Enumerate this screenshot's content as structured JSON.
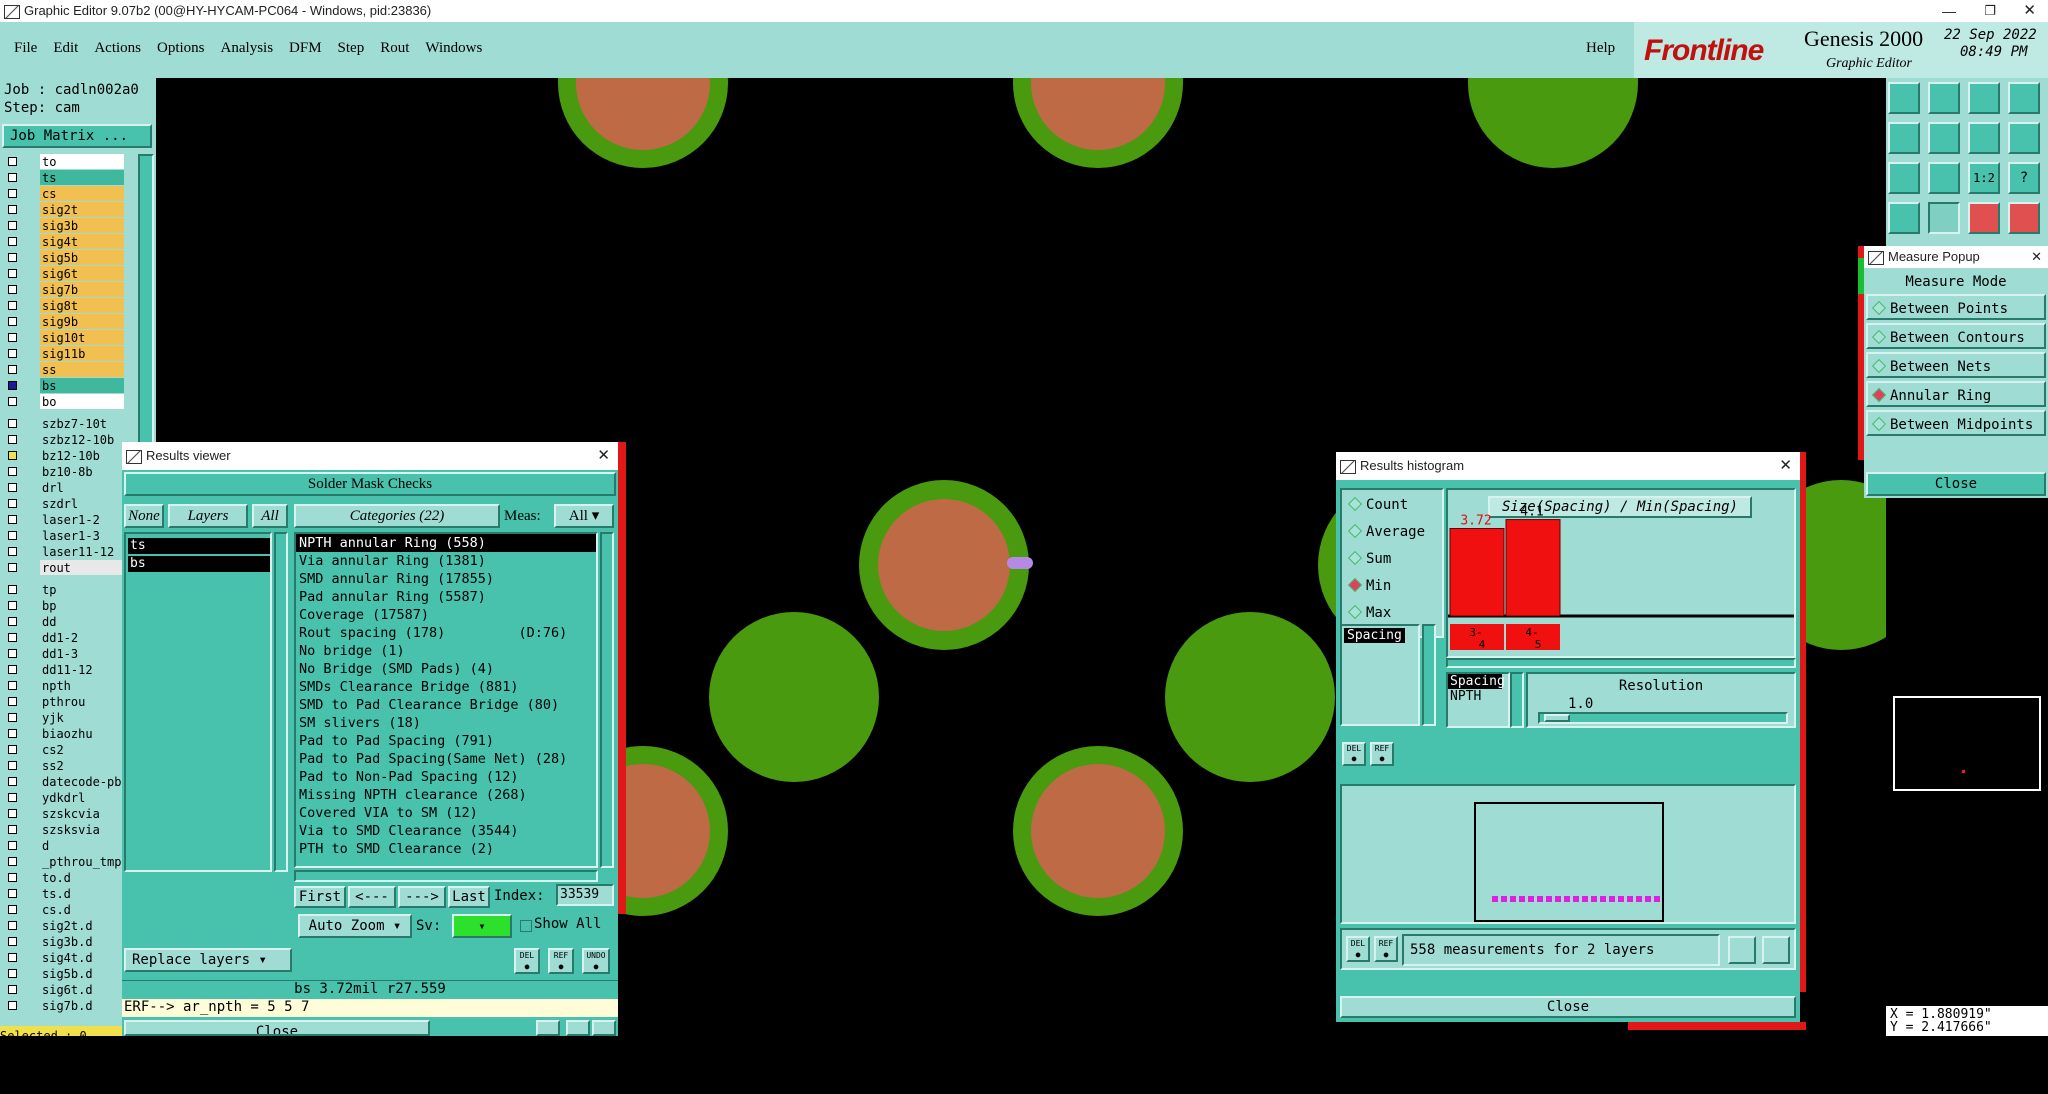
{
  "window": {
    "title": "Graphic Editor 9.07b2 (00@HY-HYCAM-PC064 - Windows, pid:23836)"
  },
  "menu": [
    "File",
    "Edit",
    "Actions",
    "Options",
    "Analysis",
    "DFM",
    "Step",
    "Rout",
    "Windows"
  ],
  "help": "Help",
  "brand": {
    "logo": "Frontline",
    "product": "Genesis 2000",
    "subtitle": "Graphic Editor",
    "date": "22 Sep 2022",
    "time": "08:49 PM"
  },
  "job": {
    "job": "Job : cadln002a0",
    "step": "Step: cam",
    "matrix_button": "Job Matrix ..."
  },
  "layers": [
    {
      "name": "to",
      "color": "#ffffff"
    },
    {
      "name": "ts",
      "color": "#3fb89e"
    },
    {
      "name": "cs",
      "color": "#f2c050"
    },
    {
      "name": "sig2t",
      "color": "#f2c050"
    },
    {
      "name": "sig3b",
      "color": "#f2c050"
    },
    {
      "name": "sig4t",
      "color": "#f2c050"
    },
    {
      "name": "sig5b",
      "color": "#f2c050"
    },
    {
      "name": "sig6t",
      "color": "#f2c050"
    },
    {
      "name": "sig7b",
      "color": "#f2c050"
    },
    {
      "name": "sig8t",
      "color": "#f2c050"
    },
    {
      "name": "sig9b",
      "color": "#f2c050"
    },
    {
      "name": "sig10t",
      "color": "#f2c050"
    },
    {
      "name": "sig11b",
      "color": "#f2c050"
    },
    {
      "name": "ss",
      "color": "#f2c050"
    },
    {
      "name": "bs",
      "color": "#3fb89e"
    },
    {
      "name": "bo",
      "color": "#ffffff"
    },
    {
      "name": "szbz7-10t",
      "color": "#9fdcd4"
    },
    {
      "name": "szbz12-10b",
      "color": "#9fdcd4"
    },
    {
      "name": "bz12-10b",
      "color": "#9fdcd4"
    },
    {
      "name": "bz10-8b",
      "color": "#9fdcd4"
    },
    {
      "name": "drl",
      "color": "#9fdcd4"
    },
    {
      "name": "szdrl",
      "color": "#9fdcd4"
    },
    {
      "name": "laser1-2",
      "color": "#9fdcd4"
    },
    {
      "name": "laser1-3",
      "color": "#9fdcd4"
    },
    {
      "name": "laser11-12",
      "color": "#9fdcd4"
    },
    {
      "name": "rout",
      "color": "#e8e8e8"
    },
    {
      "name": "tp",
      "color": "#9fdcd4"
    },
    {
      "name": "bp",
      "color": "#9fdcd4"
    },
    {
      "name": "dd",
      "color": "#9fdcd4"
    },
    {
      "name": "dd1-2",
      "color": "#9fdcd4"
    },
    {
      "name": "dd1-3",
      "color": "#9fdcd4"
    },
    {
      "name": "dd11-12",
      "color": "#9fdcd4"
    },
    {
      "name": "npth",
      "color": "#9fdcd4"
    },
    {
      "name": "pthrou",
      "color": "#9fdcd4"
    },
    {
      "name": "yjk",
      "color": "#9fdcd4"
    },
    {
      "name": "biaozhu",
      "color": "#9fdcd4"
    },
    {
      "name": "cs2",
      "color": "#9fdcd4"
    },
    {
      "name": "ss2",
      "color": "#9fdcd4"
    },
    {
      "name": "datecode-pb",
      "color": "#9fdcd4"
    },
    {
      "name": "ydkdrl",
      "color": "#9fdcd4"
    },
    {
      "name": "szskcvia",
      "color": "#9fdcd4"
    },
    {
      "name": "szsksvia",
      "color": "#9fdcd4"
    },
    {
      "name": "d",
      "color": "#9fdcd4"
    },
    {
      "name": "_pthrou_tmp",
      "color": "#9fdcd4"
    },
    {
      "name": "to.d",
      "color": "#9fdcd4"
    },
    {
      "name": "ts.d",
      "color": "#9fdcd4"
    },
    {
      "name": "cs.d",
      "color": "#9fdcd4"
    },
    {
      "name": "sig2t.d",
      "color": "#9fdcd4"
    },
    {
      "name": "sig3b.d",
      "color": "#9fdcd4"
    },
    {
      "name": "sig4t.d",
      "color": "#9fdcd4"
    },
    {
      "name": "sig5b.d",
      "color": "#9fdcd4"
    },
    {
      "name": "sig6t.d",
      "color": "#9fdcd4"
    },
    {
      "name": "sig7b.d",
      "color": "#9fdcd4"
    }
  ],
  "selected": "Selected : 0",
  "results_viewer": {
    "title": "Results viewer",
    "header": "Solder Mask Checks",
    "none": "None",
    "layers": "Layers",
    "all": "All",
    "categories_label": "Categories (22)",
    "meas_label": "Meas:",
    "meas_value": "All",
    "layer_list": [
      "ts",
      "bs"
    ],
    "categories": [
      "NPTH annular Ring (558)",
      "Via annular Ring (1381)",
      "SMD annular Ring (17855)",
      "Pad annular Ring (5587)",
      "Coverage (17587)",
      "Rout spacing (178)         (D:76)",
      "No bridge (1)",
      "No Bridge (SMD Pads) (4)",
      "SMDs Clearance Bridge (881)",
      "SMD to Pad Clearance Bridge (80)",
      "SM slivers (18)",
      "Pad to Pad Spacing (791)",
      "Pad to Pad Spacing(Same Net) (28)",
      "Pad to Non-Pad Spacing (12)",
      "Missing NPTH clearance (268)",
      "Covered VIA to SM (12)",
      "Via to SMD Clearance (3544)",
      "PTH to SMD Clearance (2)"
    ],
    "first": "First",
    "prev": "<---",
    "next": "--->",
    "last": "Last",
    "index_label": "Index:",
    "index_value": "33539",
    "auto_zoom": "Auto Zoom",
    "sv_label": "Sv:",
    "show_all": "Show All",
    "replace_layers": "Replace layers",
    "del": "DEL",
    "ref": "REF",
    "undo": "UNDO",
    "status": "bs 3.72mil  r27.559",
    "erf": "ERF--> ar_npth = 5 5 7",
    "close": "Close"
  },
  "measure_popup": {
    "title": "Measure Popup",
    "header": "Measure Mode",
    "modes": [
      "Between Points",
      "Between Contours",
      "Between Nets",
      "Annular Ring",
      "Between Midpoints"
    ],
    "selected": "Annular Ring",
    "close": "Close"
  },
  "histogram": {
    "title": "Results histogram",
    "stats": [
      "Count",
      "Average",
      "Sum",
      "Min",
      "Max"
    ],
    "selected_stat": "Min",
    "chart_title": "Size(Spacing) / Min(Spacing)",
    "list_item": "Spacing",
    "list2": [
      "Spacing",
      "NPTH"
    ],
    "resolution_label": "Resolution",
    "resolution_value": "1.0",
    "del": "DEL",
    "ref": "REF",
    "summary": "558 measurements for 2 layers",
    "close": "Close"
  },
  "chart_data": {
    "type": "bar",
    "title": "Size(Spacing) / Min(Spacing)",
    "categories": [
      "3-4",
      "4-5"
    ],
    "values": [
      3.72,
      4.1
    ],
    "value_labels": [
      "3.72",
      "4.1"
    ],
    "ylim": [
      0,
      5
    ]
  },
  "coords": {
    "x": "X = 1.880919\"",
    "y": "Y = 2.417666\""
  }
}
